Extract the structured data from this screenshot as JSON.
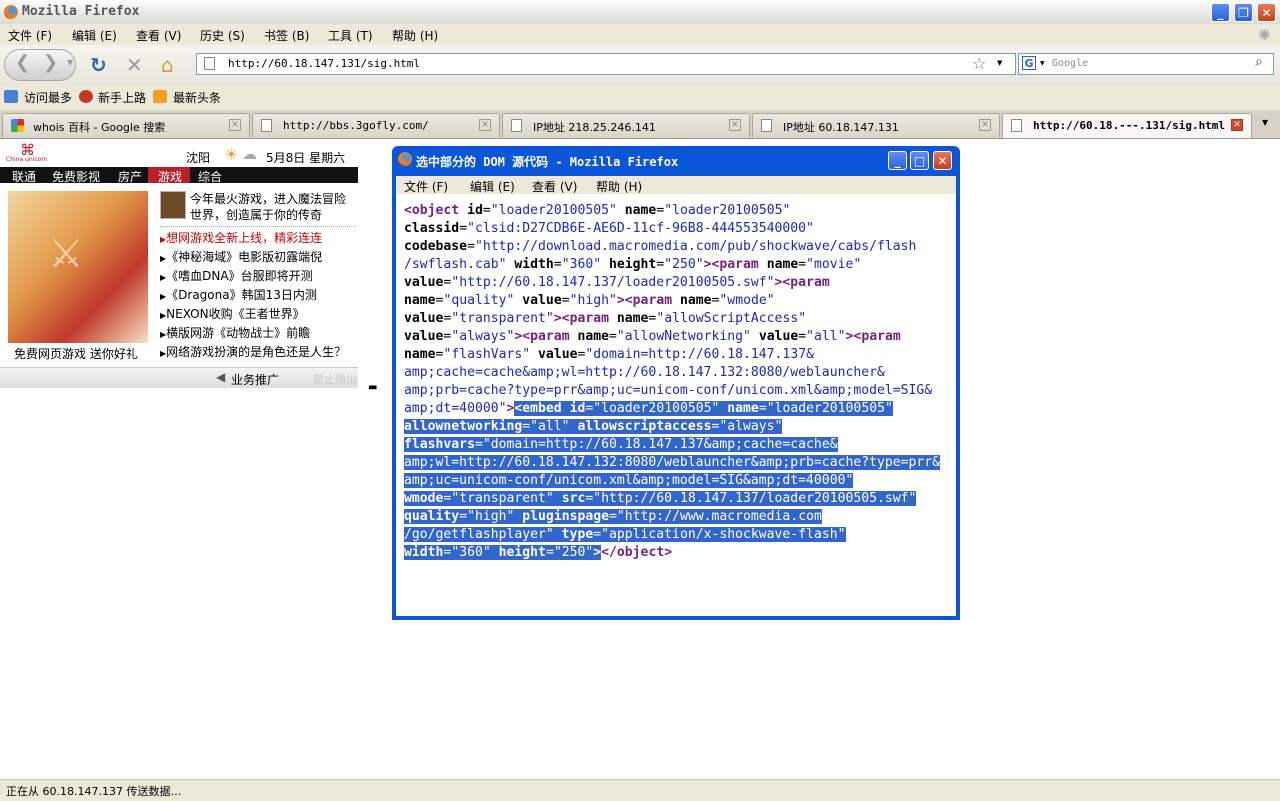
{
  "window": {
    "title": "Mozilla Firefox"
  },
  "menu": [
    "文件 (F)",
    "编辑 (E)",
    "查看 (V)",
    "历史 (S)",
    "书签 (B)",
    "工具 (T)",
    "帮助 (H)"
  ],
  "nav": {
    "url": "http://60.18.147.131/sig.html",
    "search_placeholder": "Google"
  },
  "bookmarks": [
    "访问最多",
    "新手上路",
    "最新头条"
  ],
  "tabs": [
    "whois 百科 - Google 搜索",
    "http://bbs.3gofly.com/",
    "IP地址 218.25.246.141",
    "IP地址 60.18.147.131",
    "http://60.18.---.131/sig.html"
  ],
  "page": {
    "city": "沈阳",
    "date": "5月8日 星期六",
    "categories": [
      "联通",
      "免费影视",
      "房产",
      "游戏",
      "综合"
    ],
    "feature_caption": "免费网页游戏 送你好礼",
    "headline": "今年最火游戏，进入魔法冒险世界，创造属于你的传奇",
    "headline_line1": "今年最火游戏，进入魔法冒险",
    "headline_line2": "世界，创造属于你的传奇",
    "news": [
      "想网游戏全新上线，精彩连连",
      "《神秘海域》电影版初露端倪",
      "《嗜血DNA》台服即将开测",
      "《Dragona》韩国13日内测",
      "NEXON收购《王者世界》",
      "横版网游《动物战士》前瞻",
      "网络游戏扮演的是角色还是人生？"
    ],
    "footer_link": "业务推广",
    "footer_disabled": "禁止播出"
  },
  "popup": {
    "title": "选中部分的 DOM 源代码 - Mozilla Firefox",
    "menu": [
      "文件 (F)",
      "编辑 (E)",
      "查看 (V)",
      "帮助 (H)"
    ]
  },
  "status": "正在从 60.18.147.137 传送数据…",
  "colors": {
    "accent": "#0b55d9",
    "selection": "#3266cc",
    "tag": "#7b1f80",
    "value": "#1e27bf",
    "news_red": "#cc0000"
  }
}
